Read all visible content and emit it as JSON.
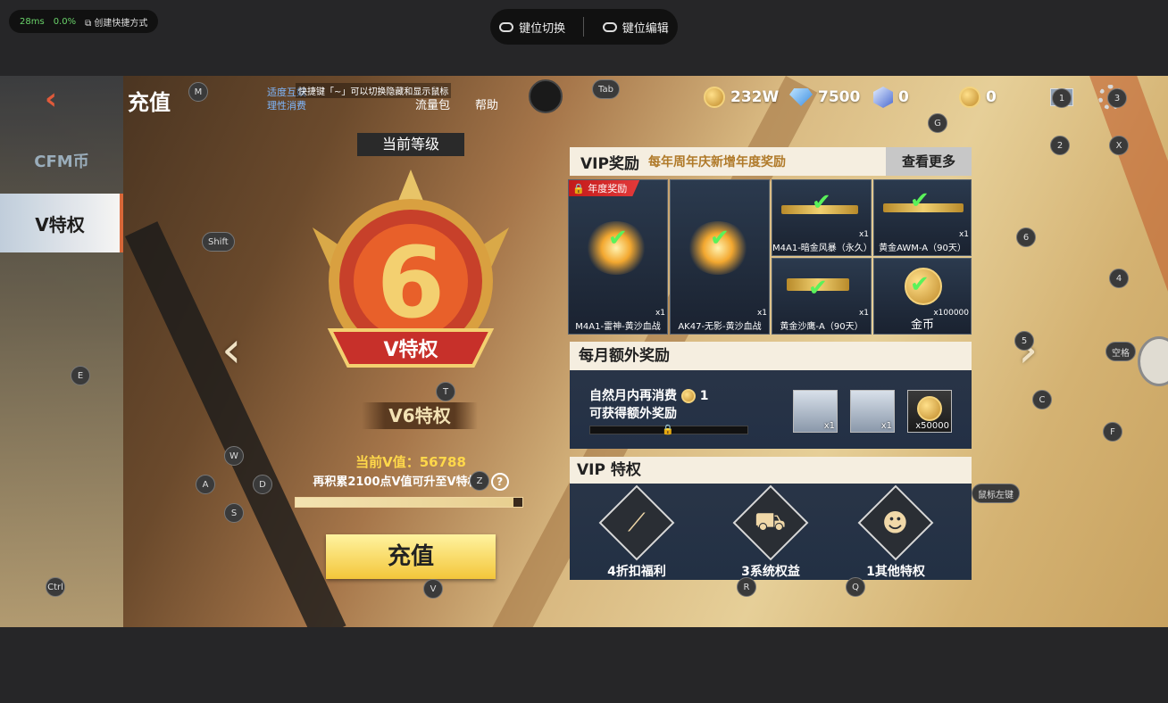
{
  "overlay": {
    "latency": "28ms",
    "loss": "0.0%",
    "shortcut_label": "创建快捷方式",
    "key_switch": "键位切换",
    "key_edit": "键位编辑"
  },
  "header": {
    "title": "充值",
    "tip_line1": "适度互娱",
    "tip_line2": "理性消费",
    "shortcut_hint": "快捷键「~」可以切换隐藏和显示鼠标",
    "traffic": "流量包",
    "help": "帮助"
  },
  "resources": [
    {
      "icon": "coin-icon",
      "value": "232W"
    },
    {
      "icon": "diamond-icon",
      "value": "7500"
    },
    {
      "icon": "hex-token-icon",
      "value": "0"
    },
    {
      "icon": "medal-icon",
      "value": "0"
    }
  ],
  "nav": {
    "cfm": "CFM币",
    "vip": "V特权"
  },
  "level": {
    "current_label": "当前等级",
    "level_number": "6",
    "ribbon": "V特权",
    "name": "V6特权",
    "vvalue": "当前V值：56788",
    "need": "再积累2100点V值可升至V特权7",
    "help": "?",
    "progress": 0.96,
    "pay": "充值"
  },
  "vip": {
    "title": "VIP奖励",
    "subtitle": "每年周年庆新增年度奖励",
    "more": "查看更多",
    "annual": "年度奖励",
    "items": [
      {
        "name": "M4A1-雷神-黄沙血战",
        "qty": "x1"
      },
      {
        "name": "AK47-无影-黄沙血战",
        "qty": "x1"
      },
      {
        "name": "M4A1-暗金风暴（永久）",
        "qty": "x1"
      },
      {
        "name": "黄金AWM-A（90天）",
        "qty": "x1"
      },
      {
        "name": "黄金沙鹰-A（90天）",
        "qty": "x1"
      },
      {
        "name": "金币",
        "qty": "x100000"
      }
    ]
  },
  "monthly": {
    "title": "每月额外奖励",
    "line1": "自然月内再消费",
    "amount": "1",
    "line2": "可获得额外奖励",
    "items": [
      {
        "qty": "x1"
      },
      {
        "qty": "x1"
      },
      {
        "qty": "x50000"
      }
    ]
  },
  "privilege": {
    "title": "VIP 特权",
    "items": [
      {
        "label": "4折扣福利"
      },
      {
        "label": "3系统权益"
      },
      {
        "label": "1其他特权"
      }
    ]
  },
  "keys": [
    "M",
    "Tab",
    "G",
    "2",
    "X",
    "6",
    "4",
    "Shift",
    "E",
    "T",
    "5",
    "空格",
    "C",
    "F",
    "W",
    "A",
    "D",
    "Z",
    "S",
    "鼠标左键",
    "Ctrl",
    "V",
    "R",
    "Q",
    "1",
    "3"
  ],
  "colors": {
    "accent": "#f3c63a",
    "vvalue": "#ffd84a",
    "nav_active": "#ffffff"
  }
}
